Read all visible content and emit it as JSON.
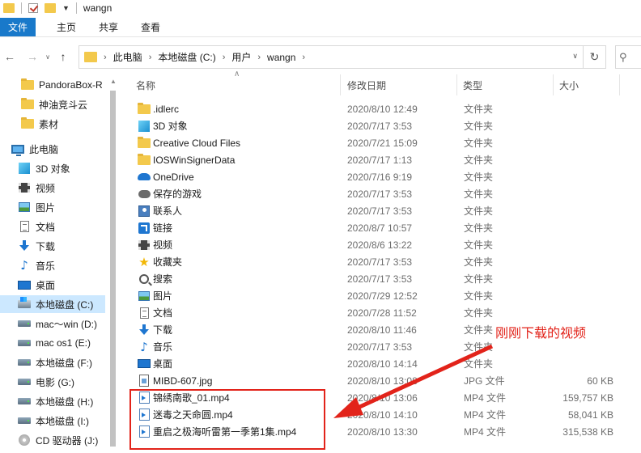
{
  "window": {
    "title": "wangn"
  },
  "ribbon": {
    "tabs": [
      "文件",
      "主页",
      "共享",
      "查看"
    ]
  },
  "address": {
    "crumbs": [
      "此电脑",
      "本地磁盘 (C:)",
      "用户",
      "wangn"
    ]
  },
  "nav": {
    "items": [
      {
        "label": "PandoraBox-R",
        "icon": "folder-icon"
      },
      {
        "label": "神油竞斗云",
        "icon": "folder-icon"
      },
      {
        "label": "素材",
        "icon": "folder-icon"
      },
      {
        "label": "此电脑",
        "icon": "pc-icon"
      },
      {
        "label": "3D 对象",
        "icon": "3d-objects-icon"
      },
      {
        "label": "视频",
        "icon": "video-icon"
      },
      {
        "label": "图片",
        "icon": "pictures-icon"
      },
      {
        "label": "文档",
        "icon": "documents-icon"
      },
      {
        "label": "下载",
        "icon": "download-icon"
      },
      {
        "label": "音乐",
        "icon": "music-icon"
      },
      {
        "label": "桌面",
        "icon": "desktop-icon"
      },
      {
        "label": "本地磁盘 (C:)",
        "icon": "windows-drive-icon",
        "selected": true
      },
      {
        "label": "mac～win (D:)",
        "icon": "drive-icon"
      },
      {
        "label": "mac os1 (E:)",
        "icon": "drive-icon"
      },
      {
        "label": "本地磁盘 (F:)",
        "icon": "drive-icon"
      },
      {
        "label": "电影 (G:)",
        "icon": "drive-icon"
      },
      {
        "label": "本地磁盘 (H:)",
        "icon": "drive-icon"
      },
      {
        "label": "本地磁盘 (I:)",
        "icon": "drive-icon"
      },
      {
        "label": "CD 驱动器 (J:)",
        "icon": "cd-drive-icon"
      }
    ]
  },
  "columns": {
    "name": "名称",
    "date": "修改日期",
    "type": "类型",
    "size": "大小"
  },
  "files": [
    {
      "name": ".idlerc",
      "date": "2020/8/10 12:49",
      "type": "文件夹",
      "size": "",
      "icon": "folder-icon"
    },
    {
      "name": "3D 对象",
      "date": "2020/7/17 3:53",
      "type": "文件夹",
      "size": "",
      "icon": "3d-objects-icon"
    },
    {
      "name": "Creative Cloud Files",
      "date": "2020/7/21 15:09",
      "type": "文件夹",
      "size": "",
      "icon": "folder-icon"
    },
    {
      "name": "IOSWinSignerData",
      "date": "2020/7/17 1:13",
      "type": "文件夹",
      "size": "",
      "icon": "folder-icon"
    },
    {
      "name": "OneDrive",
      "date": "2020/7/16 9:19",
      "type": "文件夹",
      "size": "",
      "icon": "onedrive-icon"
    },
    {
      "name": "保存的游戏",
      "date": "2020/7/17 3:53",
      "type": "文件夹",
      "size": "",
      "icon": "saved-games-icon"
    },
    {
      "name": "联系人",
      "date": "2020/7/17 3:53",
      "type": "文件夹",
      "size": "",
      "icon": "contacts-icon"
    },
    {
      "name": "链接",
      "date": "2020/8/7 10:57",
      "type": "文件夹",
      "size": "",
      "icon": "links-icon"
    },
    {
      "name": "视频",
      "date": "2020/8/6 13:22",
      "type": "文件夹",
      "size": "",
      "icon": "video-icon"
    },
    {
      "name": "收藏夹",
      "date": "2020/7/17 3:53",
      "type": "文件夹",
      "size": "",
      "icon": "favorites-icon"
    },
    {
      "name": "搜索",
      "date": "2020/7/17 3:53",
      "type": "文件夹",
      "size": "",
      "icon": "search-icon"
    },
    {
      "name": "图片",
      "date": "2020/7/29 12:52",
      "type": "文件夹",
      "size": "",
      "icon": "pictures-icon"
    },
    {
      "name": "文档",
      "date": "2020/7/28 11:52",
      "type": "文件夹",
      "size": "",
      "icon": "documents-icon"
    },
    {
      "name": "下载",
      "date": "2020/8/10 11:46",
      "type": "文件夹",
      "size": "",
      "icon": "download-icon"
    },
    {
      "name": "音乐",
      "date": "2020/7/17 3:53",
      "type": "文件夹",
      "size": "",
      "icon": "music-icon"
    },
    {
      "name": "桌面",
      "date": "2020/8/10 14:14",
      "type": "文件夹",
      "size": "",
      "icon": "desktop-icon"
    },
    {
      "name": "MIBD-607.jpg",
      "date": "2020/8/10 13:08",
      "type": "JPG 文件",
      "size": "60 KB",
      "icon": "jpg-file-icon"
    },
    {
      "name": "锦绣南歌_01.mp4",
      "date": "2020/8/10 13:06",
      "type": "MP4 文件",
      "size": "159,757 KB",
      "icon": "mp4-file-icon"
    },
    {
      "name": "迷毒之天命圆.mp4",
      "date": "2020/8/10 14:10",
      "type": "MP4 文件",
      "size": "58,041 KB",
      "icon": "mp4-file-icon"
    },
    {
      "name": "重启之极海听雷第一季第1集.mp4",
      "date": "2020/8/10 13:30",
      "type": "MP4 文件",
      "size": "315,538 KB",
      "icon": "mp4-file-icon"
    }
  ],
  "annotation": {
    "text": "刚刚下载的视频",
    "color": "#e2231a"
  },
  "colors": {
    "accent": "#1979ca",
    "selection": "#cce8ff",
    "annotation": "#e2231a"
  }
}
